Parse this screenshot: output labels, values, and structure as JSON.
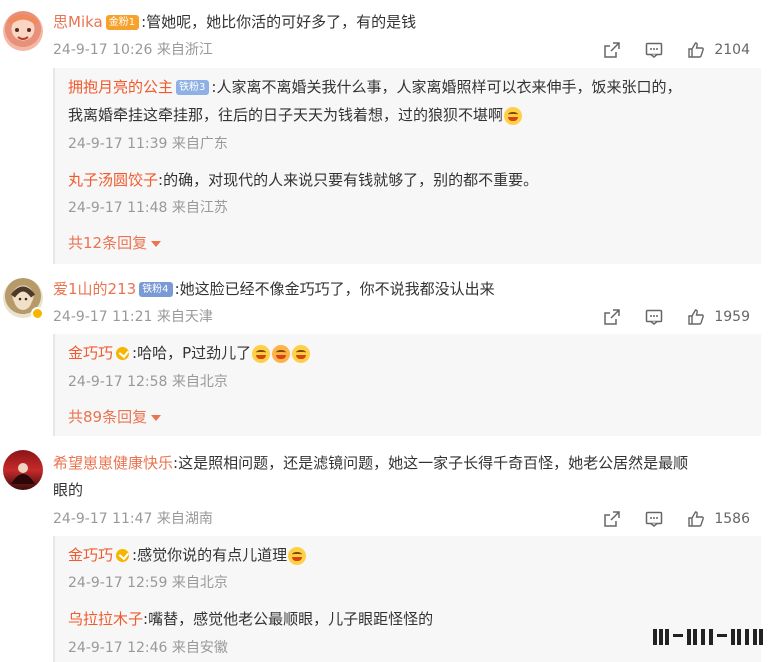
{
  "comments": [
    {
      "user": "思Mika",
      "badge": "金粉1",
      "text": ":管她呢，她比你活的可好多了，有的是钱",
      "time": "24-9-17 10:26 来自浙江",
      "likes": "2104",
      "replies": [
        {
          "user": "拥抱月亮的公主",
          "badge": "铁粉3",
          "text_line1": ":人家离不离婚关我什么事，人家离婚照样可以衣来伸手，饭来张口的，",
          "text_line2": "我离婚牵挂这牵挂那，往后的日子天天为钱着想，过的狼狈不堪啊",
          "time": "24-9-17 11:39 来自广东"
        },
        {
          "user": "丸子汤圆饺子",
          "text": ":的确，对现代的人来说只要有钱就够了，别的都不重要。",
          "time": "24-9-17 11:48 来自江苏"
        }
      ],
      "more": "共12条回复"
    },
    {
      "user": "爱1山的213",
      "badge": "铁粉4",
      "text": ":她这脸已经不像金巧巧了，你不说我都没认出来",
      "time": "24-9-17 11:21 来自天津",
      "likes": "1959",
      "replies": [
        {
          "user": "金巧巧",
          "text": ":哈哈，P过劲儿了",
          "time": "24-9-17 12:58 来自北京"
        }
      ],
      "more": "共89条回复"
    },
    {
      "user": "希望崽崽健康快乐",
      "text_line1": ":这是照相问题，还是滤镜问题，她这一家子长得千奇百怪，她老公居然是最顺",
      "text_line2": "眼的",
      "time": "24-9-17 11:47 来自湖南",
      "likes": "1586",
      "replies": [
        {
          "user": "金巧巧",
          "text": ":感觉你说的有点儿道理",
          "time": "24-9-17 12:59 来自北京"
        },
        {
          "user": "乌拉拉木子",
          "text": ":嘴替，感觉他老公最顺眼，儿子眼距怪怪的",
          "time": "24-9-17 12:46 来自安徽"
        }
      ]
    }
  ],
  "colors": {
    "username": "#eb7350",
    "meta": "#999999",
    "reply_bg": "#f7f7f7",
    "verified": "#f7b500"
  },
  "icons": [
    "share-icon",
    "comment-icon",
    "like-icon",
    "verified-icon",
    "laugh-emoji",
    "grin-emoji"
  ]
}
